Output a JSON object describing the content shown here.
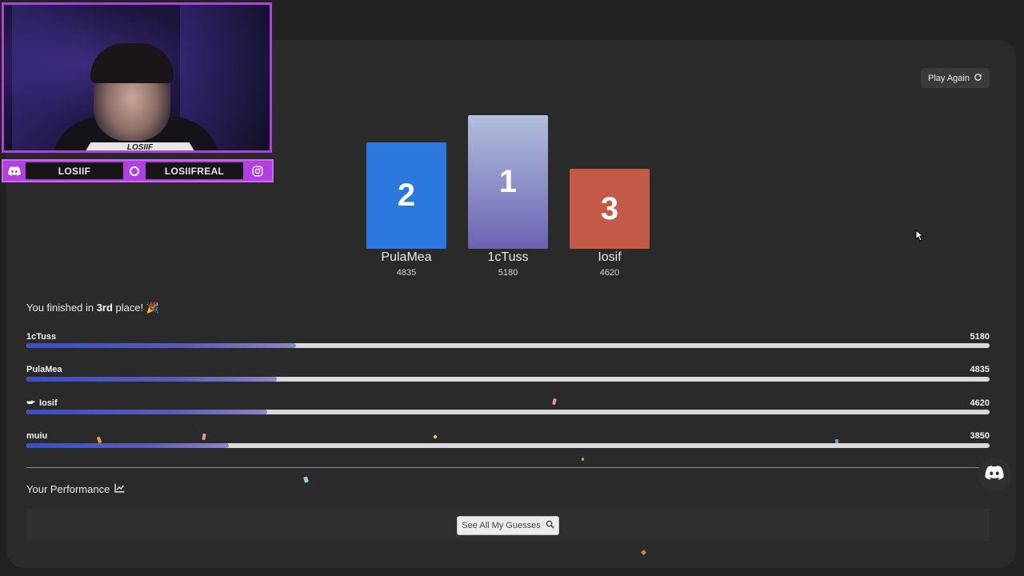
{
  "webcam": {
    "name_plate": "LOSIIF",
    "handles": [
      {
        "platform": "discord",
        "icon": "discord-icon",
        "label": "LOSIIF"
      },
      {
        "platform": "instagram",
        "icon": "instagram-icon",
        "label": "LOSIIFREAL"
      }
    ],
    "border_color": "#b23fe0"
  },
  "toolbar": {
    "play_again_label": "Play Again",
    "play_again_icon": "refresh-icon"
  },
  "podium": [
    {
      "place": "2",
      "name": "PulaMea",
      "score": "4835",
      "color": "#2a78dd"
    },
    {
      "place": "1",
      "name": "1cTuss",
      "score": "5180",
      "color": "#8e93c8"
    },
    {
      "place": "3",
      "name": "Iosif",
      "score": "4620",
      "color": "#c25a47"
    }
  ],
  "finish": {
    "prefix": "You finished in ",
    "place": "3rd",
    "suffix": " place! 🎉"
  },
  "leaderboard": [
    {
      "name": "1cTuss",
      "score": "5180",
      "fill_fraction": 0.28,
      "icon": ""
    },
    {
      "name": "PulaMea",
      "score": "4835",
      "fill_fraction": 0.26,
      "icon": ""
    },
    {
      "name": "Iosif",
      "score": "4620",
      "fill_fraction": 0.25,
      "icon": "hand-point-icon"
    },
    {
      "name": "muiu",
      "score": "3850",
      "fill_fraction": 0.21,
      "icon": ""
    }
  ],
  "performance": {
    "title": "Your Performance",
    "title_icon": "line-chart-icon",
    "button_label": "See All My Guesses",
    "button_icon": "search-icon"
  },
  "floating": {
    "discord_icon": "discord-icon"
  },
  "colors": {
    "background": "#212121",
    "panel": "#2a2a2a",
    "bar_track": "#d9d9d9",
    "bar_fill": "#3a4fc4"
  }
}
